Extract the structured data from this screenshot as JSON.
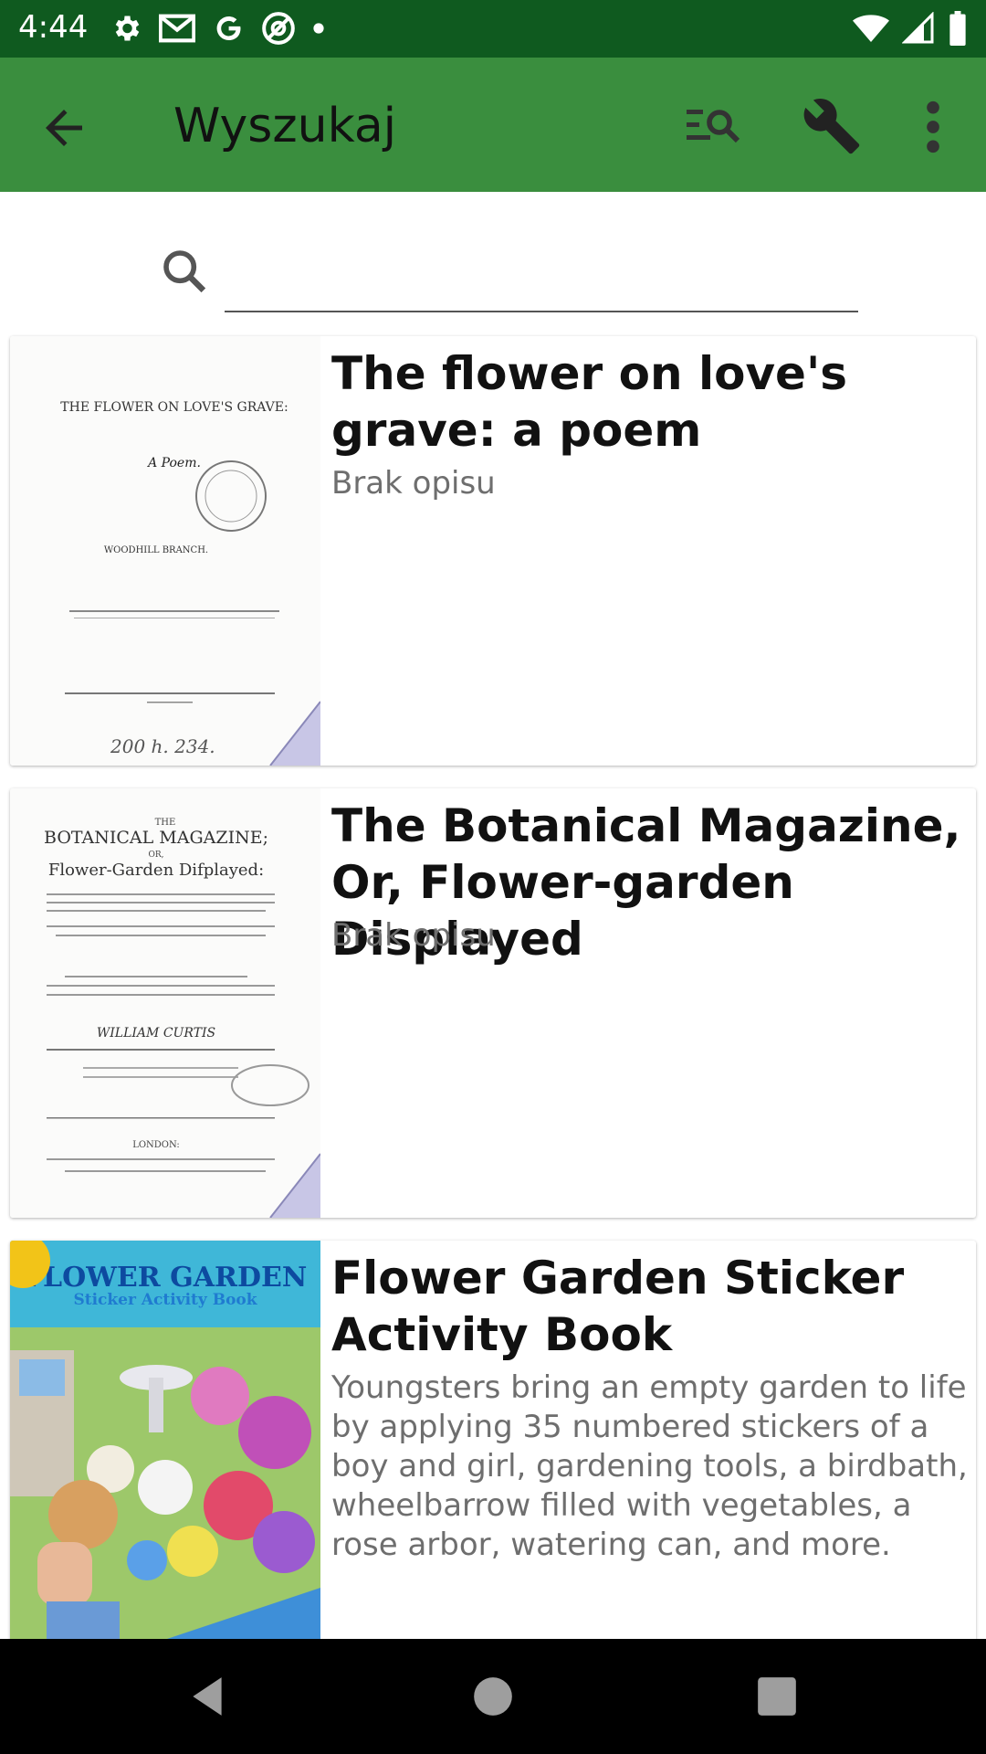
{
  "status_bar": {
    "time": "4:44"
  },
  "app_bar": {
    "title": "Wyszukaj"
  },
  "search": {
    "value": "",
    "placeholder": ""
  },
  "results": [
    {
      "title": "The flower on love's grave: a poem",
      "description": "Brak opisu",
      "cover_lines": [
        "THE FLOWER ON LOVE'S GRAVE:",
        "A Poem.",
        "WOODHILL BRANCH.",
        "200 h. 234."
      ]
    },
    {
      "title": "The Botanical Magazine, Or, Flower-garden Displayed",
      "description": "Brak opisu",
      "cover_lines": [
        "THE",
        "BOTANICAL MAGAZINE;",
        "OR,",
        "Flower-Garden Difplayed:",
        "WILLIAM CURTIS",
        "LONDON:"
      ]
    },
    {
      "title": "Flower Garden Sticker Activity Book",
      "description": "Youngsters bring an empty garden to life by applying 35 numbered stickers of a boy and girl, gardening tools, a birdbath, wheelbarrow filled with vegetables, a rose arbor, watering can, and more.",
      "cover_lines": [
        "FLOWER GARDEN",
        "Sticker Activity Book"
      ]
    }
  ],
  "colors": {
    "status_bar": "#0f5a1f",
    "app_bar": "#3a8e3e",
    "nav_bar": "#000000"
  }
}
